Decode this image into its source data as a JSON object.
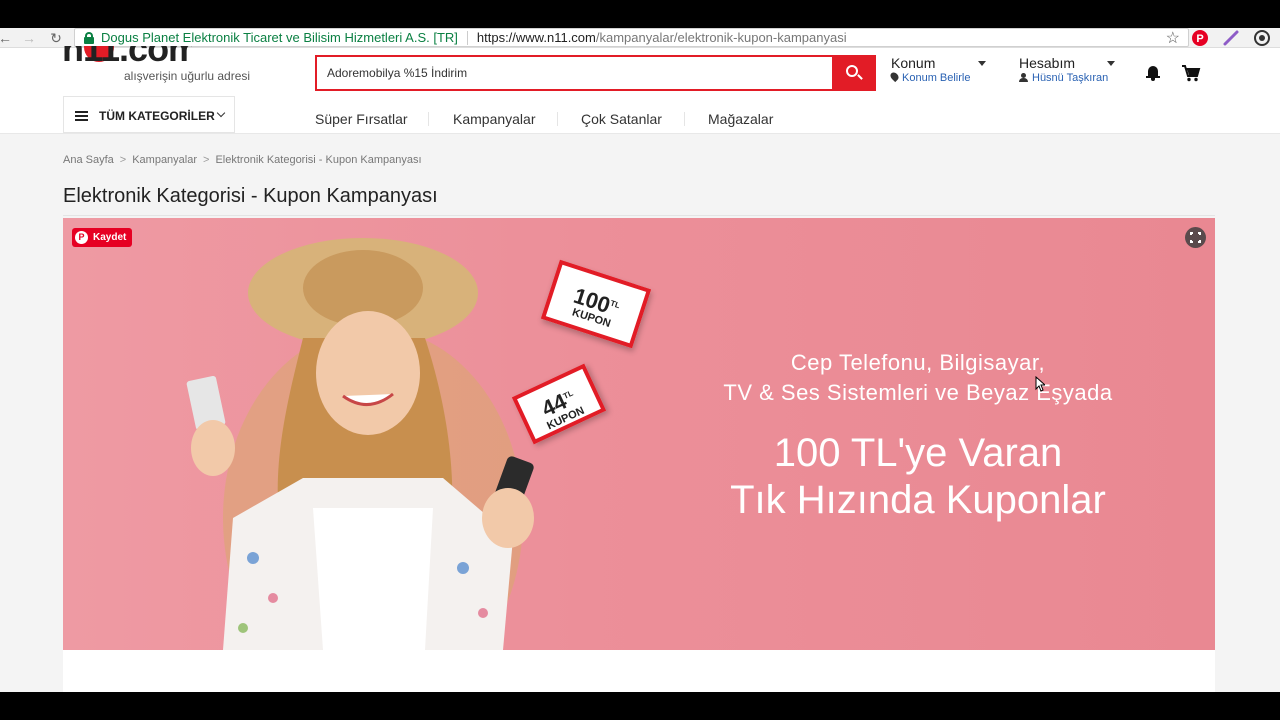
{
  "browser": {
    "cert_name": "Dogus Planet Elektronik Ticaret ve Bilisim Hizmetleri A.S. [TR]",
    "url_host": "https://www.n11.com",
    "url_path": "/kampanyalar/elektronik-kupon-kampanyasi"
  },
  "header": {
    "logo_text": "n11.com",
    "slogan": "alışverişin uğurlu adresi",
    "search_value": "Adoremobilya %15 İndirim",
    "location": {
      "title": "Konum",
      "sub": "Konum Belirle"
    },
    "account": {
      "title": "Hesabım",
      "sub": "Hüsnü Taşkıran"
    },
    "categories_label": "TÜM KATEGORİLER",
    "menu": [
      "Süper Fırsatlar",
      "Kampanyalar",
      "Çok Satanlar",
      "Mağazalar"
    ]
  },
  "breadcrumb": [
    "Ana Sayfa",
    "Kampanyalar",
    "Elektronik Kategorisi - Kupon Kampanyası"
  ],
  "page_title": "Elektronik Kategorisi - Kupon Kampanyası",
  "banner": {
    "save_label": "Kaydet",
    "line1a": "Cep Telefonu, Bilgisayar,",
    "line1b": "TV & Ses Sistemleri ve Beyaz Eşyada",
    "line2a": "100 TL'ye Varan",
    "line2b": "Tık Hızında Kuponlar",
    "coupons": [
      {
        "amount": "100",
        "unit": "TL",
        "label": "KUPON"
      },
      {
        "amount": "44",
        "unit": "TL",
        "label": "KUPON"
      }
    ]
  },
  "colors": {
    "brand": "#e21c26",
    "banner": "#ec8f99",
    "link": "#2a62b3"
  }
}
